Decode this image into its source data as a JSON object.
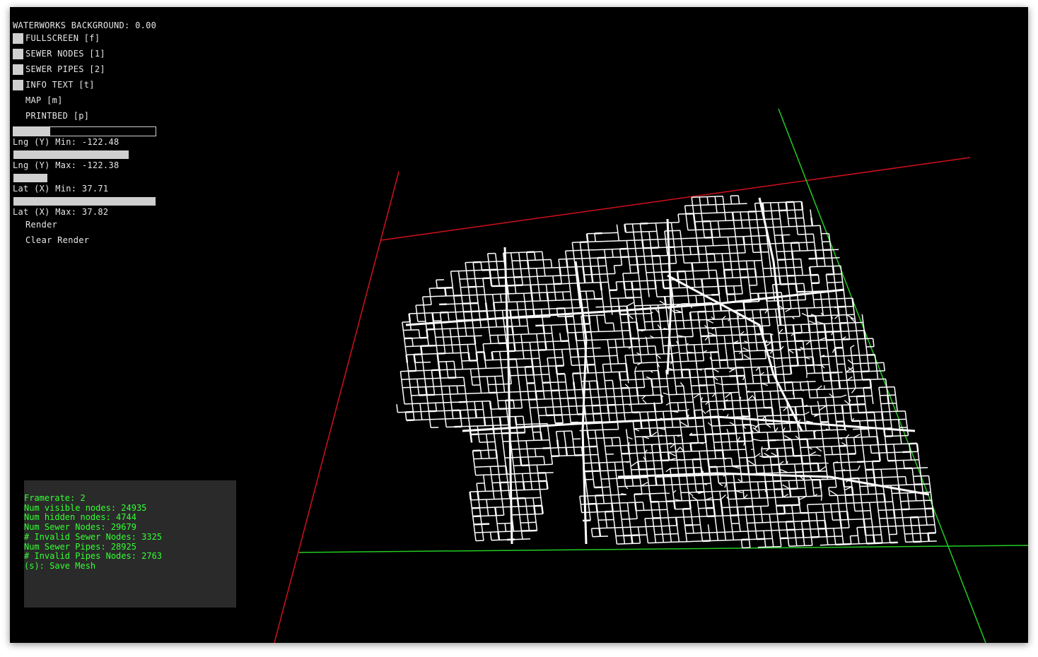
{
  "window": {
    "background": "#000000"
  },
  "gui": {
    "background_label": "WATERWORKS BACKGROUND: 0.00",
    "toggles": [
      {
        "label": "FULLSCREEN [f]"
      },
      {
        "label": "SEWER NODES [1]"
      },
      {
        "label": "SEWER PIPES [2]"
      },
      {
        "label": "INFO TEXT [t]"
      }
    ],
    "buttons": [
      {
        "label": "MAP [m]"
      },
      {
        "label": "PRINTBED [p]"
      }
    ],
    "sliders": [
      {
        "label": "Lng (Y) Min: -122.48",
        "fraction": 0.26
      },
      {
        "label": "Lng (Y) Max: -122.38",
        "fraction": 0.81
      },
      {
        "label": "Lat (X) Min: 37.71",
        "fraction": 0.24
      },
      {
        "label": "Lat (X) Max: 37.82",
        "fraction": 1.0
      }
    ],
    "actions": [
      {
        "label": "Render"
      },
      {
        "label": "Clear Render"
      }
    ]
  },
  "info": {
    "lines": [
      "Framerate: 2",
      "Num visible nodes: 24935",
      "Num hidden nodes: 4744",
      "Num Sewer Nodes: 29679",
      "# Invalid Sewer Nodes: 3325",
      "Num Sewer Pipes: 28925",
      "# Invalid Pipes Nodes: 2763",
      "(s): Save Mesh"
    ],
    "text_color": "#33ff33",
    "panel_color": "#2a2a2a"
  },
  "scene": {
    "axis_red": "#d0101c",
    "axis_green": "#22cc22",
    "network_color": "#ffffff"
  }
}
